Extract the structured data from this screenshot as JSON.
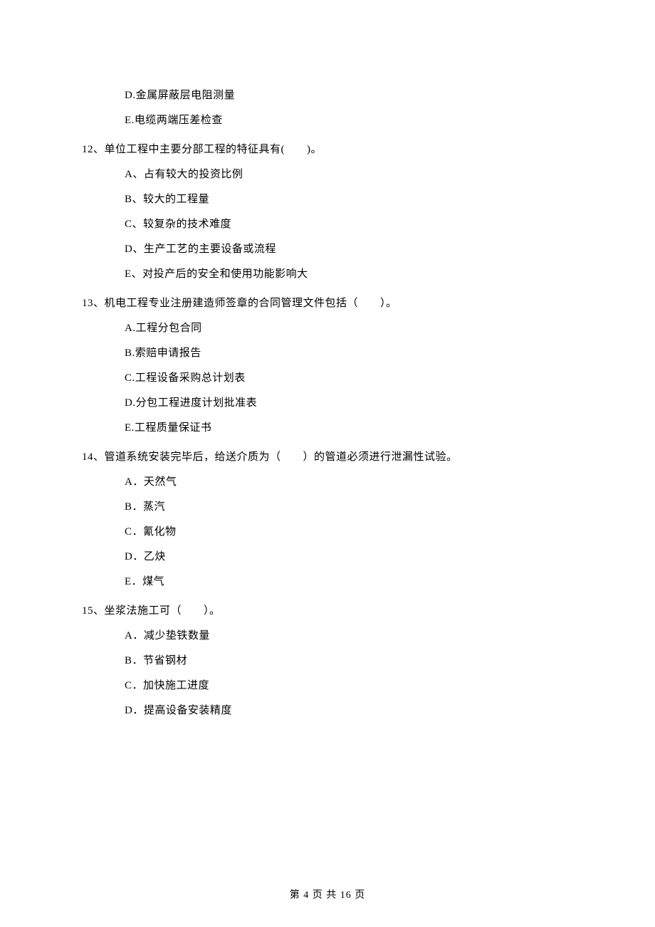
{
  "prev_options": {
    "d": "D.金属屏蔽层电阻测量",
    "e": "E.电缆两端压差检查"
  },
  "q12": {
    "stem": "12、单位工程中主要分部工程的特征具有(　　)。",
    "a": "A、占有较大的投资比例",
    "b": "B、较大的工程量",
    "c": "C、较复杂的技术难度",
    "d": "D、生产工艺的主要设备或流程",
    "e": "E、对投产后的安全和使用功能影响大"
  },
  "q13": {
    "stem": "13、机电工程专业注册建造师签章的合同管理文件包括（　　）。",
    "a": "A.工程分包合同",
    "b": "B.索赔申请报告",
    "c": "C.工程设备采购总计划表",
    "d": "D.分包工程进度计划批准表",
    "e": "E.工程质量保证书"
  },
  "q14": {
    "stem": "14、管道系统安装完毕后，给送介质为（　　）的管道必须进行泄漏性试验。",
    "a": "A．天然气",
    "b": "B．蒸汽",
    "c": "C．氰化物",
    "d": "D．乙炔",
    "e": "E．煤气"
  },
  "q15": {
    "stem": "15、坐浆法施工可（　　）。",
    "a": "A．减少垫铁数量",
    "b": "B．节省钢材",
    "c": "C．加快施工进度",
    "d": "D．提高设备安装精度"
  },
  "footer": "第 4 页 共 16 页"
}
